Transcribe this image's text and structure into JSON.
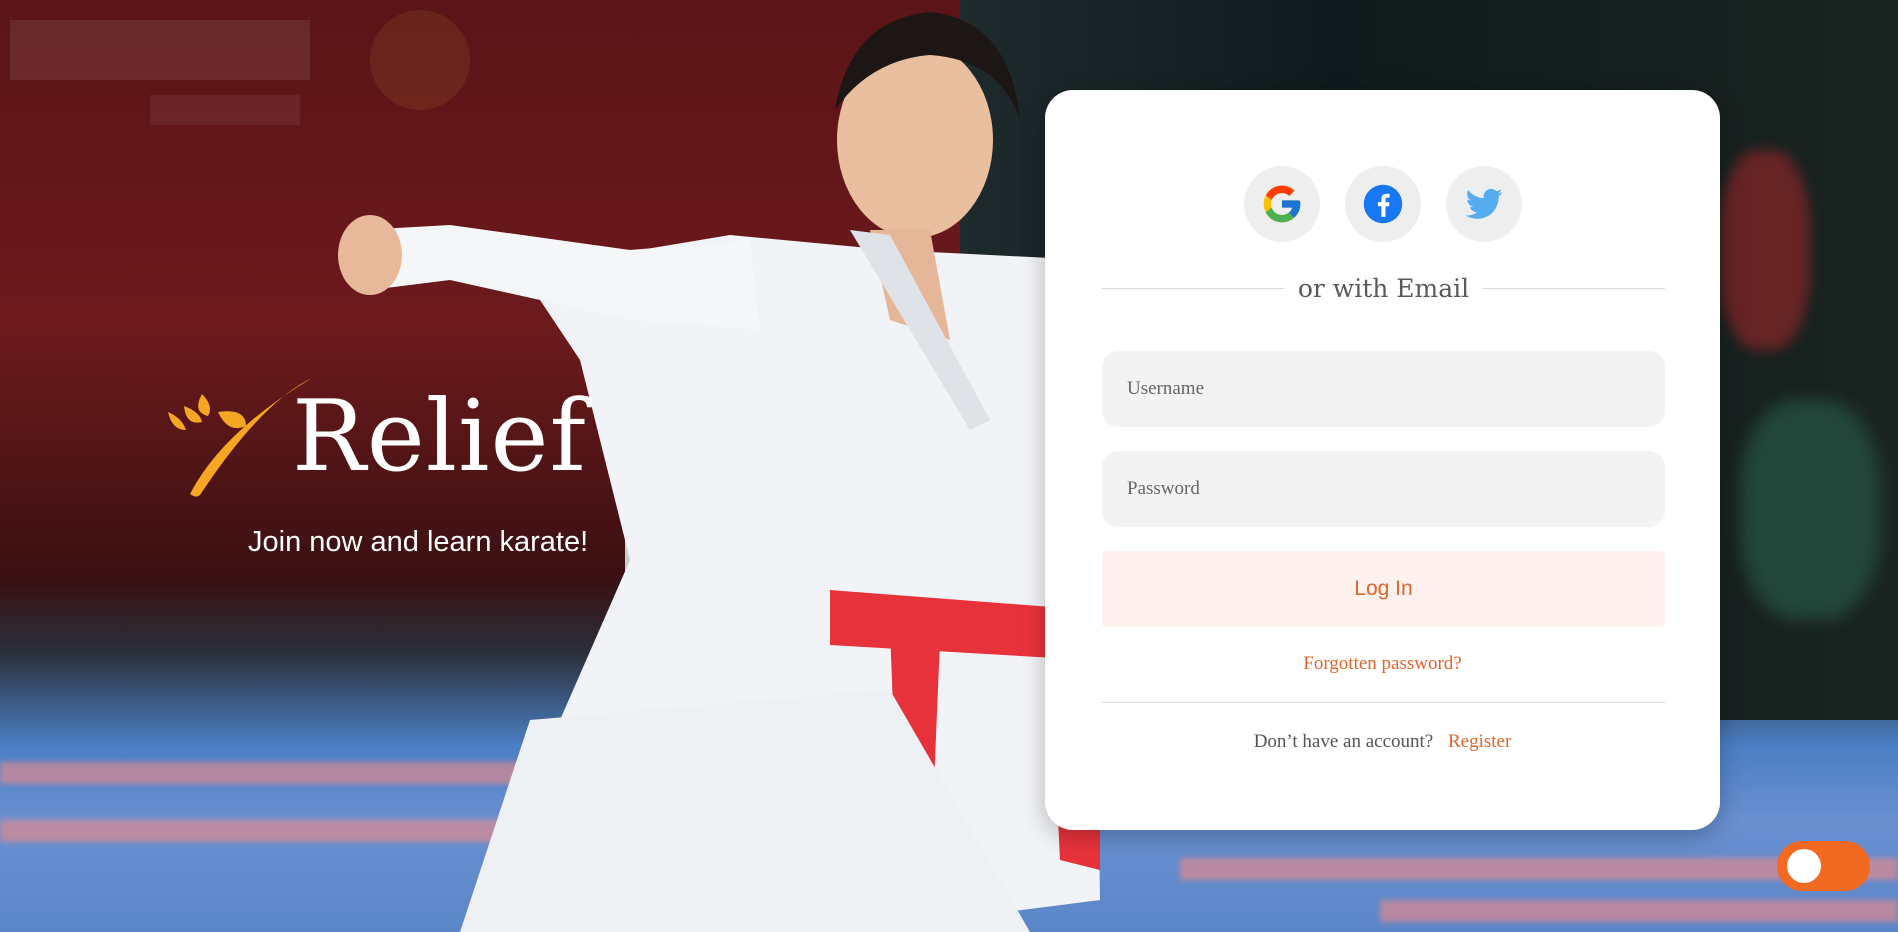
{
  "hero": {
    "brand_name": "Relief",
    "tagline": "Join now and learn karate!"
  },
  "login": {
    "social": [
      {
        "name": "google",
        "icon": "google-icon"
      },
      {
        "name": "facebook",
        "icon": "facebook-icon"
      },
      {
        "name": "twitter",
        "icon": "twitter-icon"
      }
    ],
    "divider_text": "or with Email",
    "username_placeholder": "Username",
    "password_placeholder": "Password",
    "login_label": "Log In",
    "forgot_label": "Forgotten password?",
    "no_account_text": "Don’t have an account?",
    "register_label": "Register"
  },
  "theme_toggle": {
    "state": "on"
  },
  "colors": {
    "accent": "#e0652a",
    "toggle": "#f26a22",
    "login_bg": "#fff1ee",
    "field_bg": "#f3f3f3",
    "logo_gold": "#f5a623"
  }
}
